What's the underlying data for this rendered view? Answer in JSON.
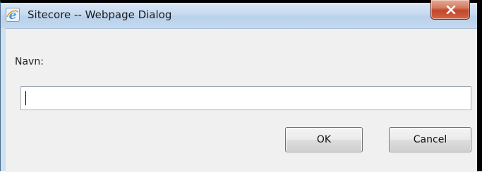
{
  "window": {
    "title": "Sitecore -- Webpage Dialog",
    "app_icon": "internet-explorer-icon",
    "close_icon": "close-x-icon",
    "close_color": "#c9452b"
  },
  "form": {
    "name_label": "Navn:",
    "name_value": "",
    "name_placeholder": ""
  },
  "buttons": {
    "ok_label": "OK",
    "cancel_label": "Cancel"
  }
}
